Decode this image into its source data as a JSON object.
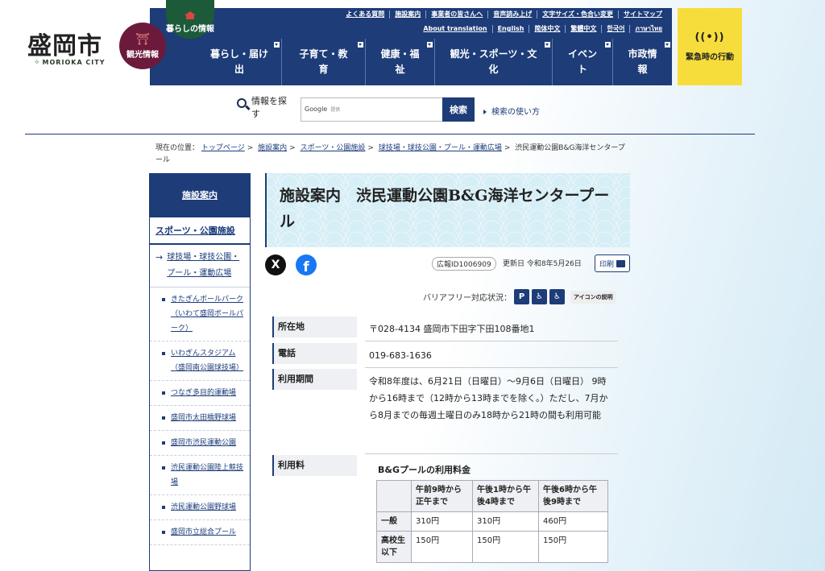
{
  "header": {
    "logo_text": "盛岡市",
    "logo_sub": "MORIOKA CITY",
    "kanko_label": "観光情報",
    "kurashi_label": "暮らしの情報",
    "util_links_row1": [
      "よくある質問",
      "施設案内",
      "事業者の皆さんへ",
      "音声読み上げ",
      "文字サイズ・色合い変更",
      "サイトマップ"
    ],
    "util_links_row2": [
      "About translation",
      "English",
      "简体中文",
      "繁體中文",
      "한국어",
      "ภาษาไทย"
    ],
    "nav": [
      {
        "line1": "暮らし・届け",
        "line2": "出"
      },
      {
        "line1": "子育て・教",
        "line2": "育"
      },
      {
        "line1": "健康・福",
        "line2": "祉"
      },
      {
        "line1": "観光・スポーツ・文",
        "line2": "化"
      },
      {
        "line1": "イベン",
        "line2": "ト"
      },
      {
        "line1": "市政情",
        "line2": "報"
      }
    ],
    "emergency_icon": "((•))",
    "emergency_label": "緊急時の行動"
  },
  "search": {
    "label": "情報を探す",
    "input_brand": "Google",
    "input_tiny": "提供",
    "button": "検索",
    "help_link": "検索の使い方"
  },
  "breadcrumb": {
    "prefix": "現在の位置：",
    "links": [
      "トップページ",
      "施設案内",
      "スポーツ・公園施設",
      "球技場・球技公園・プール・運動広場"
    ],
    "current": "渋民運動公園B&G海洋センタープール"
  },
  "sidebar": {
    "head": "施設案内",
    "sub": "スポーツ・公園施設",
    "current_arrow": "→",
    "current": "球技場・球技公園・プール・運動広場",
    "items": [
      "きたぎんボールパーク（いわて盛岡ボールパーク）",
      "いわぎんスタジアム（盛岡南公園球技場）",
      "つなぎ多目的運動場",
      "盛岡市太田橋野球場",
      "盛岡市渋民運動公園",
      "渋民運動公園陸上競技場",
      "渋民運動公園野球場",
      "盛岡市立総合プール"
    ]
  },
  "main": {
    "title": "施設案内　渋民運動公園B&G海洋センタープール",
    "sns_x": "X",
    "sns_fb": "f",
    "koho_id": "広報ID1006909",
    "updated": "更新日 令和8年5月26日",
    "print": "印刷",
    "barrier_label": "バリアフリー対応状況：",
    "barrier_icons": [
      "P",
      "♿",
      "♿"
    ],
    "barrier_explain": "アイコンの説明",
    "info": [
      {
        "label": "所在地",
        "value": "〒028-4134 盛岡市下田字下田108番地1"
      },
      {
        "label": "電話",
        "value": "019-683-1636"
      },
      {
        "label": "利用期間",
        "value": "令和8年度は、6月21日（日曜日）～9月6日（日曜日） 9時から16時まで（12時から13時までを除く。）ただし、7月から8月までの毎週土曜日のみ18時から21時の間も利用可能"
      },
      {
        "label": "利用料",
        "value": ""
      }
    ],
    "fee_title": "B&Gプールの利用料金",
    "fee_table": {
      "headers": [
        "",
        "午前9時から正午まで",
        "午後1時から午後4時まで",
        "午後6時から午後9時まで"
      ],
      "rows": [
        [
          "一般",
          "310円",
          "310円",
          "460円"
        ],
        [
          "高校生以下",
          "150円",
          "150円",
          "150円"
        ]
      ]
    }
  },
  "colors": {
    "navy": "#1d3c78",
    "emergency": "#f7dd3c",
    "kanko": "#6c1a3c",
    "kurashi": "#1d5a3a"
  }
}
